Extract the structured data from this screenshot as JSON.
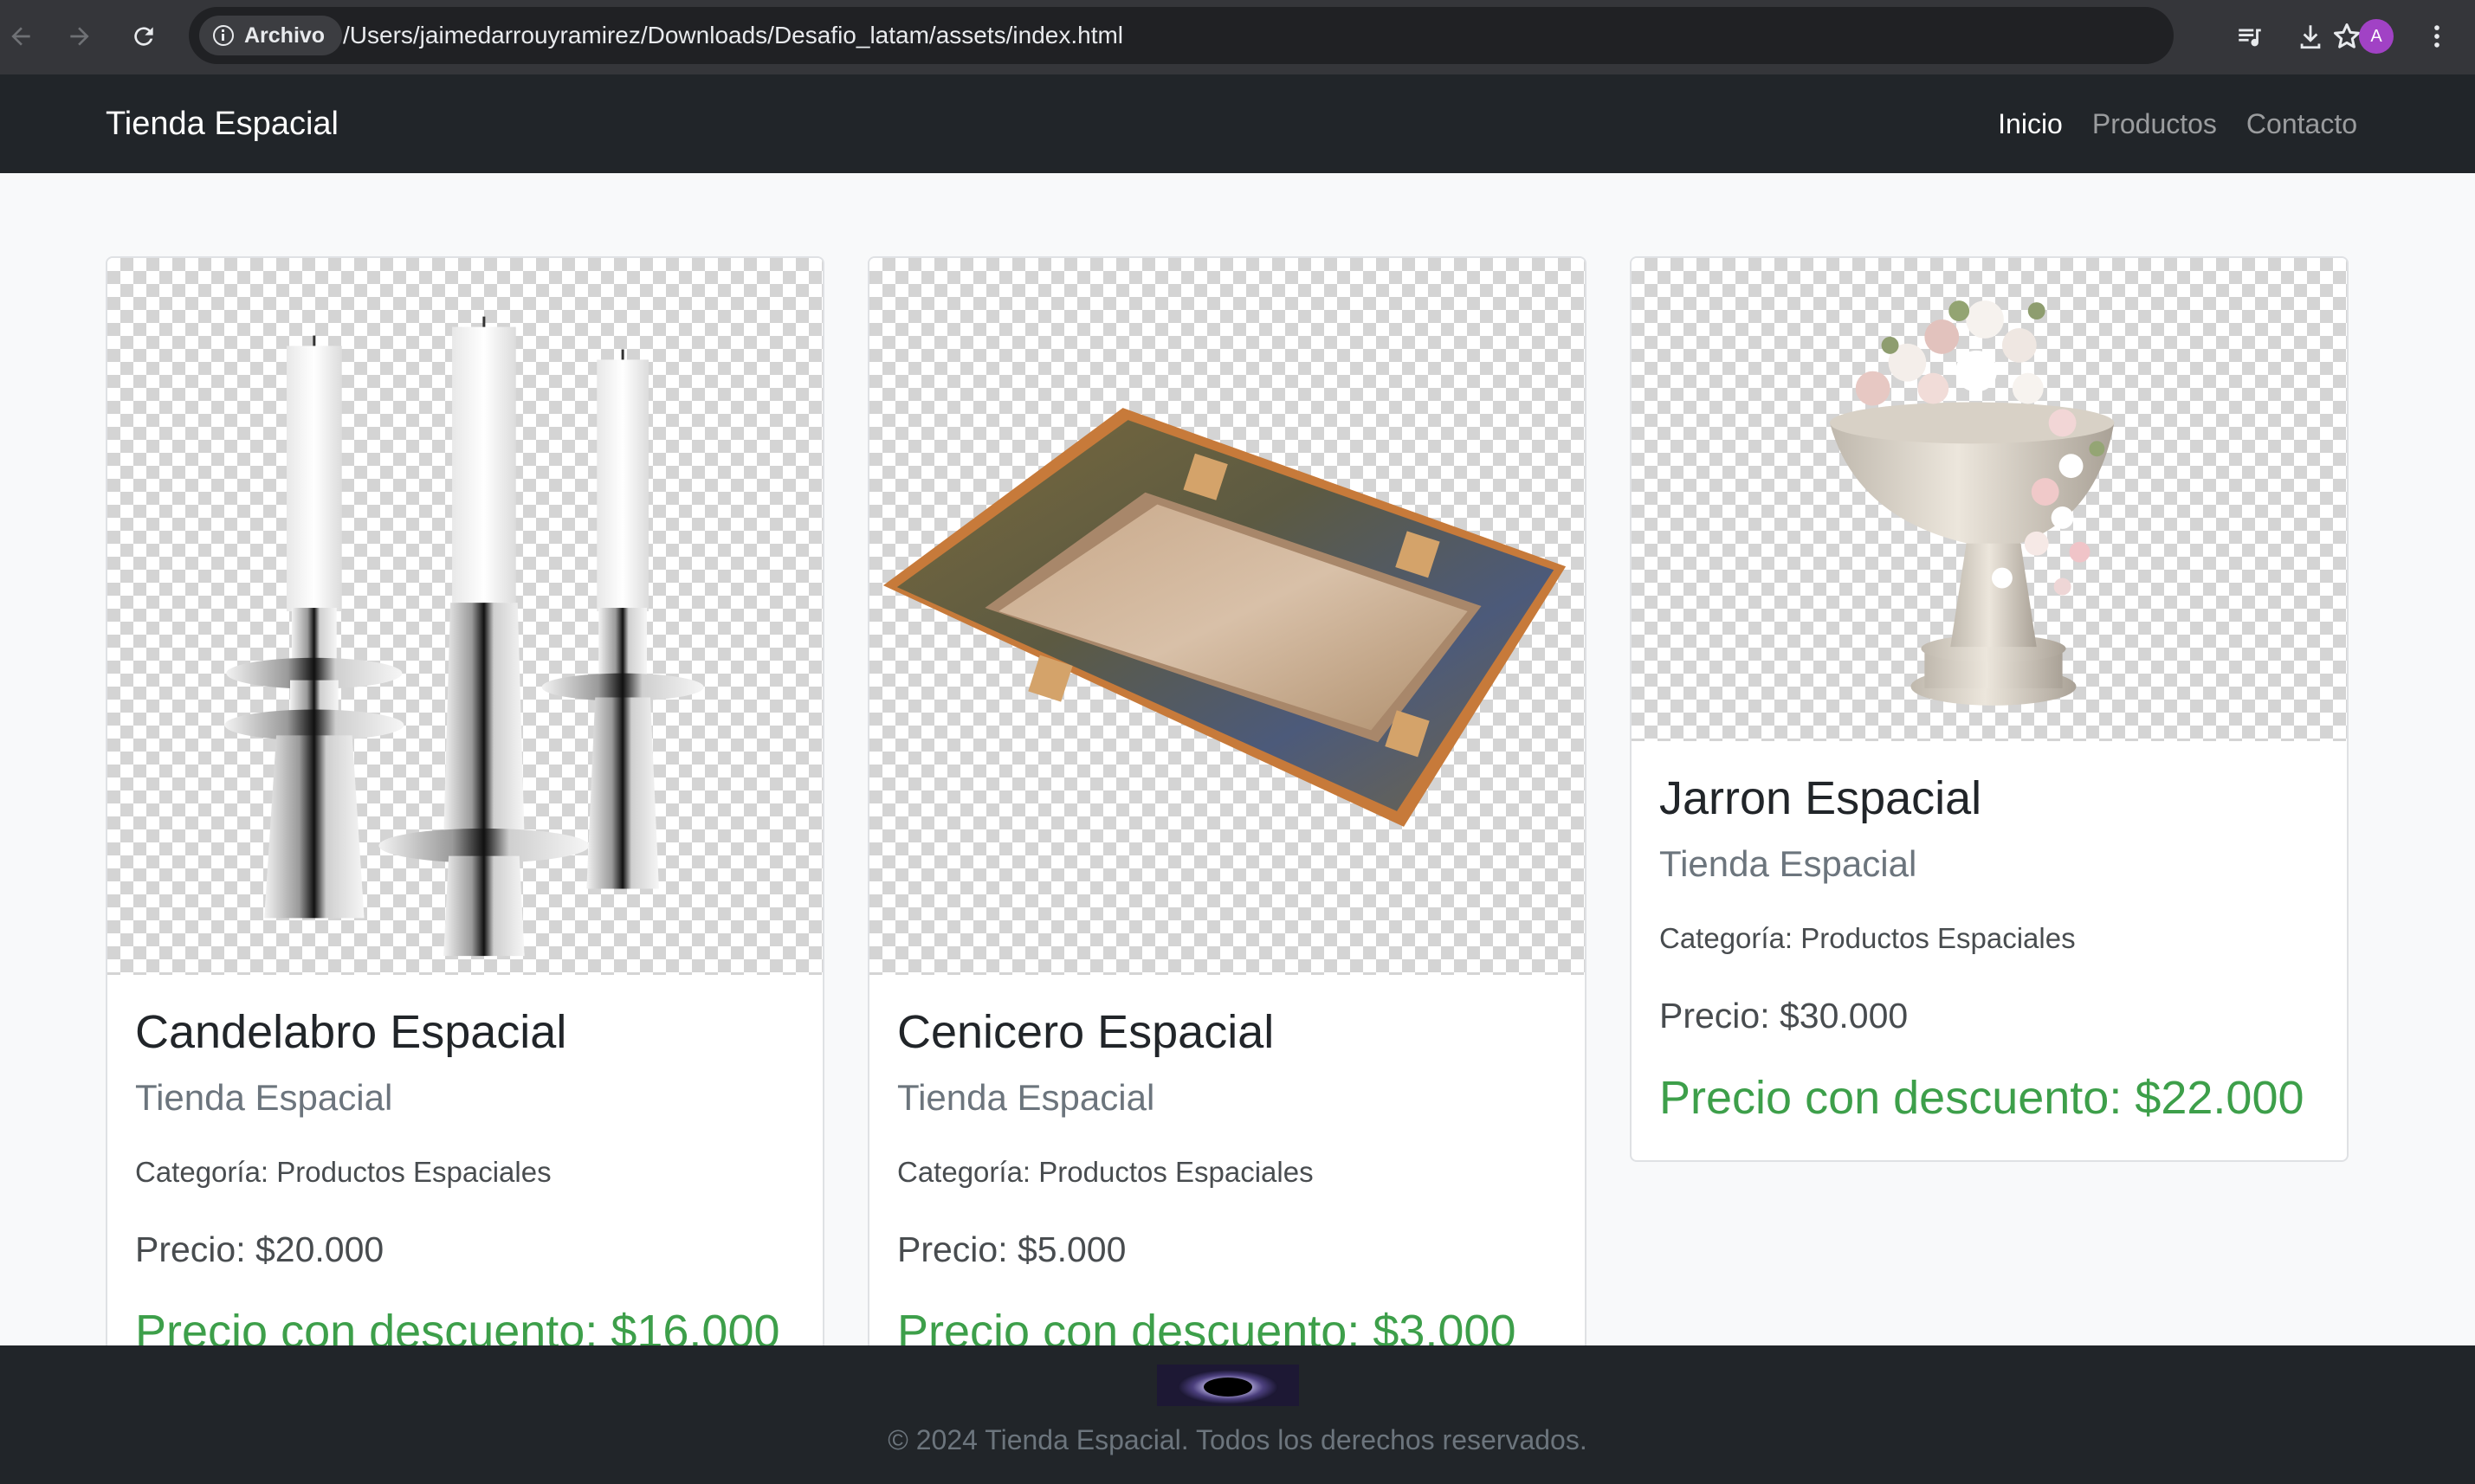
{
  "browser": {
    "site_chip": "Archivo",
    "url": "/Users/jaimedarrouyramirez/Downloads/Desafio_latam/assets/index.html",
    "avatar_initial": "A"
  },
  "navbar": {
    "brand": "Tienda Espacial",
    "links": [
      {
        "label": "Inicio",
        "active": true
      },
      {
        "label": "Productos",
        "active": false
      },
      {
        "label": "Contacto",
        "active": false
      }
    ]
  },
  "products": [
    {
      "title": "Candelabro Espacial",
      "subtitle": "Tienda Espacial",
      "category": "Categoría: Productos Espaciales",
      "price": "Precio: $20.000",
      "discount": "Precio con descuento: $16.000",
      "image_icon": "candelabra-image"
    },
    {
      "title": "Cenicero Espacial",
      "subtitle": "Tienda Espacial",
      "category": "Categoría: Productos Espaciales",
      "price": "Precio: $5.000",
      "discount": "Precio con descuento: $3.000",
      "image_icon": "ashtray-image"
    },
    {
      "title": "Jarron Espacial",
      "subtitle": "Tienda Espacial",
      "category": "Categoría: Productos Espaciales",
      "price": "Precio: $30.000",
      "discount": "Precio con descuento: $22.000",
      "image_icon": "vase-image"
    }
  ],
  "footer": {
    "logo_icon": "black-hole-logo",
    "text": "© 2024 Tienda Espacial. Todos los derechos reservados."
  },
  "colors": {
    "navbar_bg": "#212529",
    "discount_green": "#3d9f4a",
    "page_bg": "#f8f9fa"
  }
}
